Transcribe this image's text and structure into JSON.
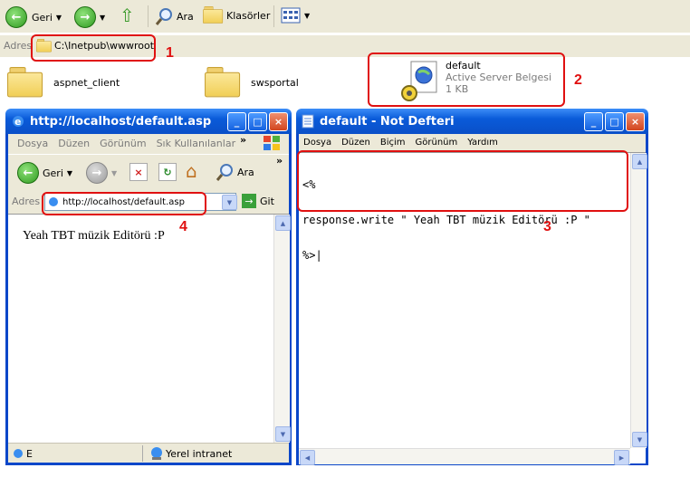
{
  "explorer": {
    "toolbar": {
      "back_label": "Geri",
      "search_label": "Ara",
      "folders_label": "Klasörler"
    },
    "address": {
      "label": "Adres",
      "path": "C:\\Inetpub\\wwwroot"
    },
    "items": [
      {
        "name": "aspnet_client"
      },
      {
        "name": "swsportal"
      },
      {
        "name": "default",
        "type": "Active Server Belgesi",
        "size": "1 KB"
      }
    ]
  },
  "browser": {
    "title": "http://localhost/default.asp",
    "menu": [
      "Dosya",
      "Düzen",
      "Görünüm",
      "Sık Kullanılanlar"
    ],
    "back_label": "Geri",
    "search_label": "Ara",
    "address_label": "Adres",
    "url": "http://localhost/default.asp",
    "go_label": "Git",
    "content": "Yeah TBT müzik Editörü :P",
    "status_left": "E",
    "status_zone": "Yerel intranet"
  },
  "notepad": {
    "title": "default - Not Defteri",
    "menu": [
      "Dosya",
      "Düzen",
      "Biçim",
      "Görünüm",
      "Yardım"
    ],
    "lines": [
      "<%",
      "response.write \" Yeah TBT müzik Editörü :P \"",
      "%>|"
    ]
  },
  "annotations": [
    "1",
    "2",
    "3",
    "4"
  ],
  "colors": {
    "annotation": "#e01010",
    "titlebar": "#0a5bd9",
    "toolbar": "#ece9d8"
  }
}
